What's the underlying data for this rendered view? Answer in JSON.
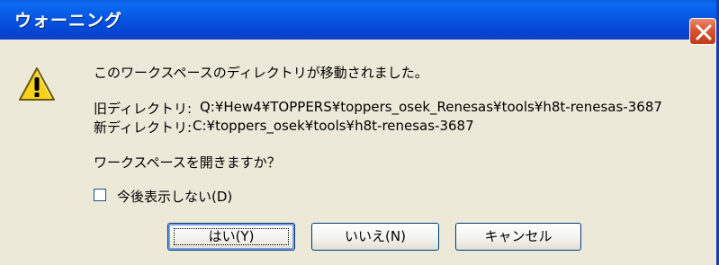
{
  "window": {
    "title": "ウォーニング",
    "close_icon": "close-icon"
  },
  "dialog": {
    "icon": "warning-icon",
    "message": "このワークスペースのディレクトリが移動されました。",
    "old_dir_label": "旧ディレクトリ:",
    "old_dir_path": "Q:¥Hew4¥TOPPERS¥toppers_osek_Renesas¥tools¥h8t-renesas-3687",
    "new_dir_label": "新ディレクトリ:",
    "new_dir_path": "C:¥toppers_osek¥tools¥h8t-renesas-3687",
    "question": "ワークスペースを開きますか？",
    "checkbox_label": "今後表示しない(D)",
    "checkbox_checked": false
  },
  "buttons": {
    "yes": "はい(Y)",
    "no": "いいえ(N)",
    "cancel": "キャンセル"
  },
  "colors": {
    "titlebar": "#0a5fe0",
    "dialog_bg": "#ece9d8",
    "close_button": "#d8542f",
    "warning_yellow": "#f7d21c"
  }
}
